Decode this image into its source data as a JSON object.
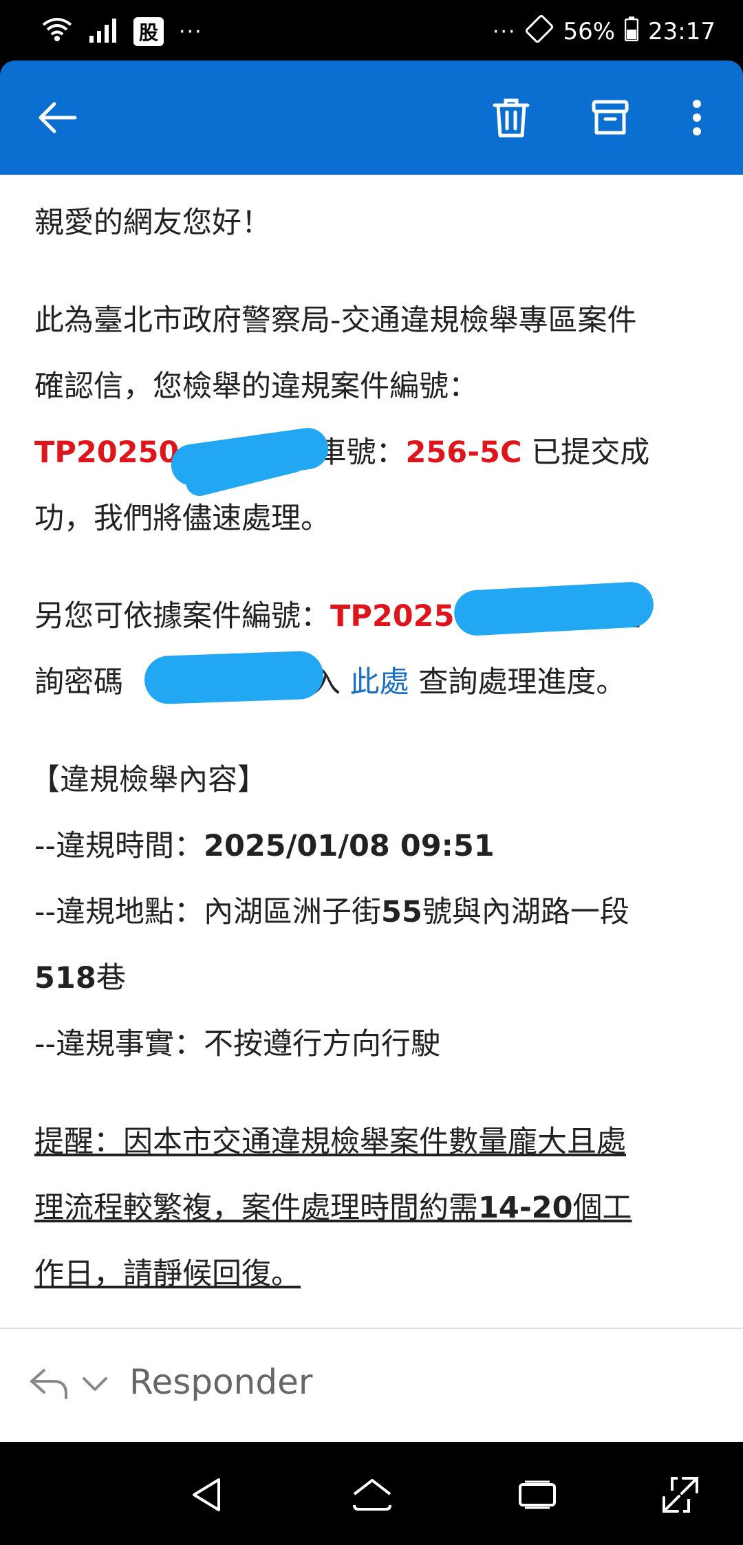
{
  "status_bar": {
    "badge": "股",
    "dots_left": "···",
    "dots_right": "···",
    "battery": "56%",
    "time": "23:17"
  },
  "app_bar": {
    "icons": [
      "back-arrow-icon",
      "trash-icon",
      "archive-icon",
      "more-vert-icon"
    ],
    "accent_color": "#0a6fd0"
  },
  "email": {
    "greeting": "親愛的網友您好！",
    "para1": {
      "line1": "此為臺北市政府警察局-交通違規檢舉專區案件",
      "line2": "確認信，您檢舉的違規案件編號：",
      "case_no_visible": "TP20250",
      "plate_label": "車號：",
      "plate": "256-5C",
      "submitted": " 已提交成",
      "line4": "功，我們將儘速處理。"
    },
    "para2": {
      "prefix": "另您可依據案件編號：",
      "case_no_visible": "TP2025",
      "suffix1": "與查",
      "line2_prefix": "詢密碼",
      "line2_enter": "進入 ",
      "link": "此處",
      "line2_suffix": " 查詢處理進度。"
    },
    "details": {
      "heading": "【違規檢舉內容】",
      "time_label": "--違規時間：",
      "time_value": "2025/01/08 09:51",
      "place_label": "--違規地點：內湖區洲子街",
      "place_num": "55",
      "place_mid": "號與內湖路一段",
      "place_line2_num": "518",
      "place_line2": "巷",
      "fact": "--違規事實：不按遵行方向行駛"
    },
    "reminder": {
      "line1": "提醒：因本市交通違規檢舉案件數量龐大且處",
      "line2_a": "理流程較繁複，案件處理時間約需",
      "line2_num": "14-20",
      "line2_b": "個工",
      "line3": "作日，請靜候回復。"
    }
  },
  "reply": {
    "label": "Responder"
  },
  "colors": {
    "highlight_red": "#e0141b",
    "link_blue": "#1a6fc4",
    "redaction": "#22a8f2"
  }
}
